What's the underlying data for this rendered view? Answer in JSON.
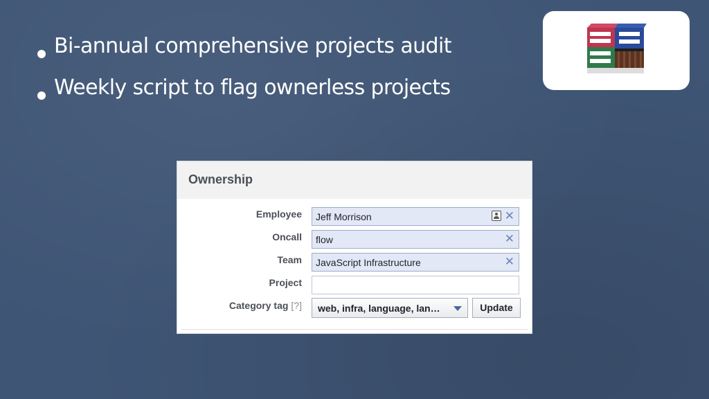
{
  "slide": {
    "bullets": [
      "Bi-annual comprehensive projects audit",
      "Weekly script to flag ownerless projects"
    ]
  },
  "logo": {
    "icon": "archive-boxes-icon"
  },
  "ownership": {
    "title": "Ownership",
    "employee": {
      "label": "Employee",
      "value": "Jeff Morrison"
    },
    "oncall": {
      "label": "Oncall",
      "value": "flow"
    },
    "team": {
      "label": "Team",
      "value": "JavaScript Infrastructure"
    },
    "project": {
      "label": "Project",
      "value": ""
    },
    "category": {
      "label": "Category tag",
      "help": "[?]",
      "value": "web, infra, language, lan…"
    },
    "update_label": "Update",
    "colors": {
      "token_bg": "#e2e8f6",
      "token_border": "#9daccb",
      "remove_x": "#6d84b4",
      "background": "#3f5575"
    }
  }
}
